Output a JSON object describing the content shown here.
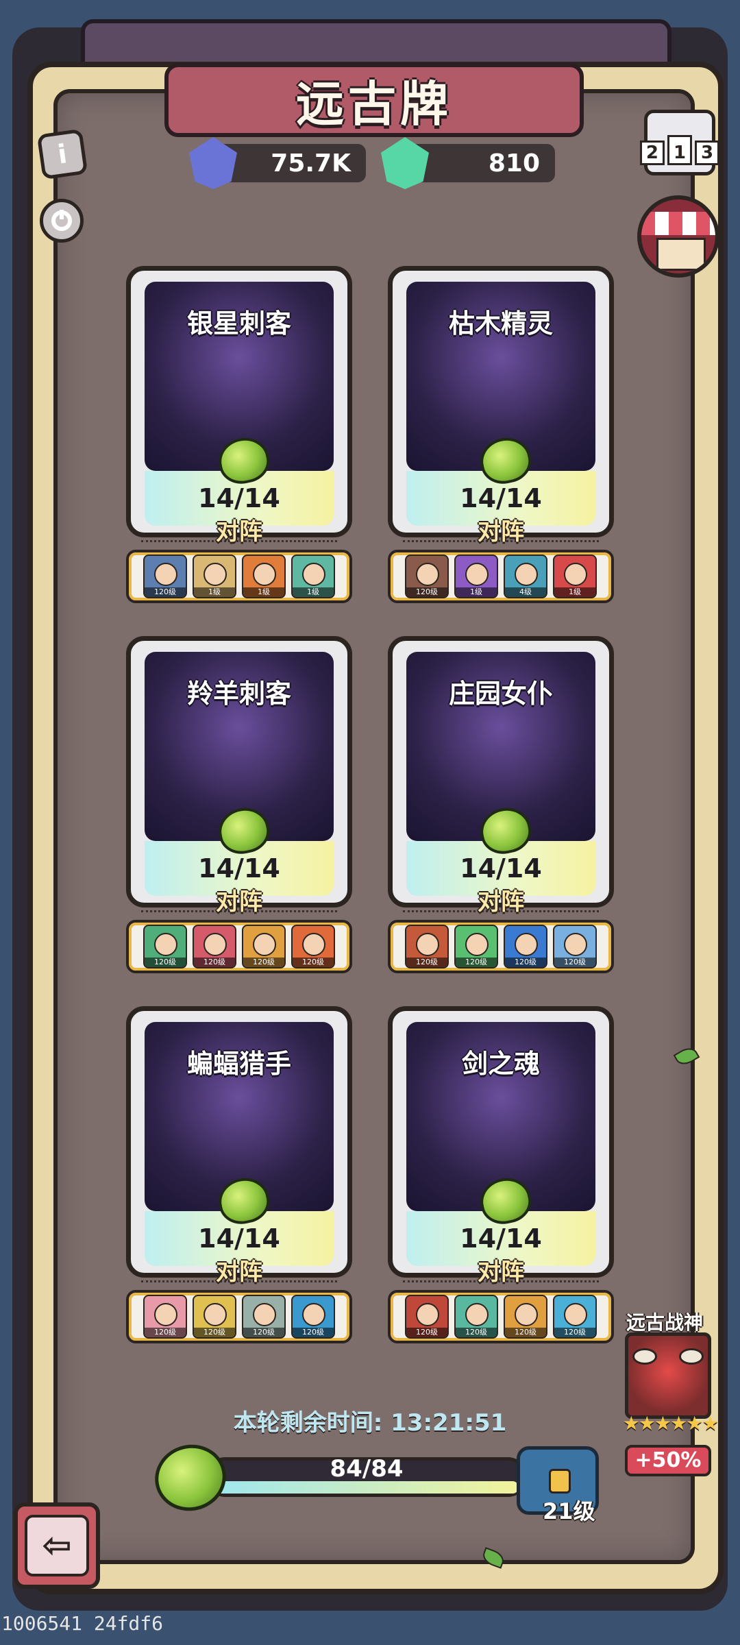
{
  "header": {
    "title": "远古牌"
  },
  "resources": [
    {
      "name": "blue-gem",
      "value": "75.7K",
      "color": "#6a74d6"
    },
    {
      "name": "green-gem",
      "value": "810",
      "color": "#57d7a6"
    }
  ],
  "side_buttons": {
    "info_symbol": "i",
    "rank_digits": [
      "2",
      "1",
      "3"
    ]
  },
  "cards": [
    {
      "name": "银星刺客",
      "progress": "14/14",
      "lineup_label": "对阵",
      "lineup": [
        {
          "level": "120级",
          "color": "#5c7fb0"
        },
        {
          "level": "1级",
          "color": "#d8b872"
        },
        {
          "level": "1级",
          "color": "#e07d3a"
        },
        {
          "level": "1级",
          "color": "#5fb8a2"
        }
      ]
    },
    {
      "name": "枯木精灵",
      "progress": "14/14",
      "lineup_label": "对阵",
      "lineup": [
        {
          "level": "120级",
          "color": "#8a5a4a"
        },
        {
          "level": "1级",
          "color": "#8c5cc4"
        },
        {
          "level": "4级",
          "color": "#4aa0b8"
        },
        {
          "level": "1级",
          "color": "#d84a4a"
        }
      ]
    },
    {
      "name": "羚羊刺客",
      "progress": "14/14",
      "lineup_label": "对阵",
      "lineup": [
        {
          "level": "120级",
          "color": "#4fae7a"
        },
        {
          "level": "120级",
          "color": "#d55a6a"
        },
        {
          "level": "120级",
          "color": "#e0a040"
        },
        {
          "level": "120级",
          "color": "#e06a3a"
        }
      ]
    },
    {
      "name": "庄园女仆",
      "progress": "14/14",
      "lineup_label": "对阵",
      "lineup": [
        {
          "level": "120级",
          "color": "#c45a3a"
        },
        {
          "level": "120级",
          "color": "#58c070"
        },
        {
          "level": "120级",
          "color": "#3a7ad0"
        },
        {
          "level": "120级",
          "color": "#7ab0e0"
        }
      ]
    },
    {
      "name": "蝙蝠猎手",
      "progress": "14/14",
      "lineup_label": "对阵",
      "lineup": [
        {
          "level": "120级",
          "color": "#e89aa8"
        },
        {
          "level": "120级",
          "color": "#e0c050"
        },
        {
          "level": "120级",
          "color": "#98b0a8"
        },
        {
          "level": "120级",
          "color": "#3a9ad0"
        }
      ]
    },
    {
      "name": "剑之魂",
      "progress": "14/14",
      "lineup_label": "对阵",
      "lineup": [
        {
          "level": "120级",
          "color": "#c0483a"
        },
        {
          "level": "120级",
          "color": "#58b8a0"
        },
        {
          "level": "120级",
          "color": "#e0a040"
        },
        {
          "level": "120级",
          "color": "#4ab0d8"
        }
      ]
    }
  ],
  "timer": {
    "text": "本轮剩余时间: 13:21:51"
  },
  "progress": {
    "text": "84/84",
    "fraction": 1.0
  },
  "chest": {
    "level_text": "21级"
  },
  "ancient_god": {
    "label": "远古战神",
    "stars": "★★★★★★",
    "bonus": "+50%"
  },
  "back_button": {
    "symbol": "⇦"
  },
  "footer": {
    "build_id": "1006541 24fdf6"
  }
}
